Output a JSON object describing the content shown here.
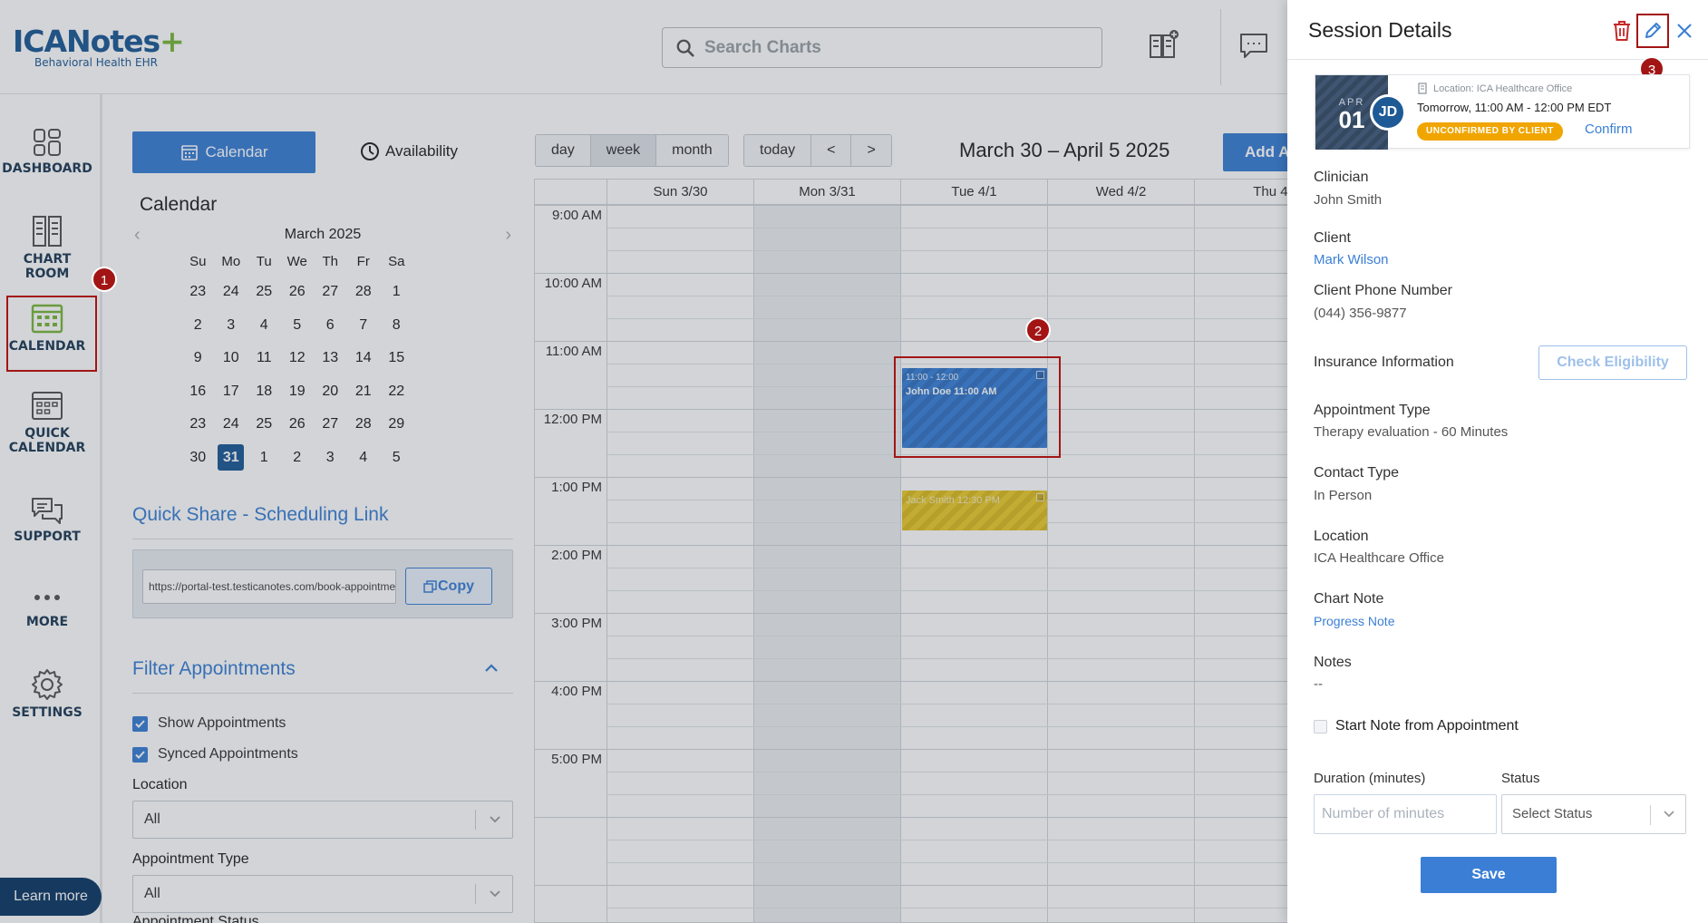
{
  "header": {
    "logo_main": "ICANotes",
    "logo_sub": "Behavioral Health EHR",
    "search_placeholder": "Search Charts"
  },
  "nav": {
    "items": [
      {
        "label": "DASHBOARD",
        "icon": "dashboard-icon"
      },
      {
        "label": "CHART ROOM",
        "icon": "chart-room-icon"
      },
      {
        "label": "CALENDAR",
        "icon": "calendar-icon"
      },
      {
        "label": "QUICK",
        "label2": "CALENDAR",
        "icon": "quick-calendar-icon"
      },
      {
        "label": "SUPPORT",
        "icon": "support-icon"
      },
      {
        "label": "MORE",
        "icon": "more-icon"
      },
      {
        "label": "SETTINGS",
        "icon": "settings-icon"
      }
    ],
    "learn_more": "Learn more"
  },
  "panel": {
    "calendar_btn": "Calendar",
    "availability_btn": "Availability",
    "title": "Calendar",
    "mini_cal": {
      "month": "March 2025",
      "day_names": [
        "Su",
        "Mo",
        "Tu",
        "We",
        "Th",
        "Fr",
        "Sa"
      ],
      "weeks": [
        [
          "23",
          "24",
          "25",
          "26",
          "27",
          "28",
          "1"
        ],
        [
          "2",
          "3",
          "4",
          "5",
          "6",
          "7",
          "8"
        ],
        [
          "9",
          "10",
          "11",
          "12",
          "13",
          "14",
          "15"
        ],
        [
          "16",
          "17",
          "18",
          "19",
          "20",
          "21",
          "22"
        ],
        [
          "23",
          "24",
          "25",
          "26",
          "27",
          "28",
          "29"
        ],
        [
          "30",
          "31",
          "1",
          "2",
          "3",
          "4",
          "5"
        ]
      ],
      "today": "31"
    },
    "quick_share": {
      "title": "Quick Share - Scheduling Link",
      "url": "https://portal-test.testicanotes.com/book-appointment",
      "copy_label": "Copy"
    },
    "filter": {
      "title": "Filter Appointments",
      "show_appointments": "Show Appointments",
      "synced_appointments": "Synced Appointments",
      "location_label": "Location",
      "location_value": "All",
      "appt_type_label": "Appointment Type",
      "appt_type_value": "All",
      "appt_status_label": "Appointment Status"
    }
  },
  "calendar": {
    "views": [
      "day",
      "week",
      "month"
    ],
    "selected_view": "week",
    "nav": [
      "today",
      "<",
      ">"
    ],
    "range_title": "March 30 – April 5 2025",
    "add_btn": "Add A",
    "columns": [
      "Sun 3/30",
      "Mon 3/31",
      "Tue 4/1",
      "Wed 4/2",
      "Thu 4/"
    ],
    "times": [
      "9:00 AM",
      "10:00 AM",
      "11:00 AM",
      "12:00 PM",
      "1:00 PM",
      "2:00 PM",
      "3:00 PM",
      "4:00 PM",
      "5:00 PM"
    ],
    "events": [
      {
        "time": "11:00 - 12:00",
        "title": "John Doe 11:00 AM",
        "color": "#3b82d8"
      },
      {
        "time": "",
        "title": "Jack Smith 12:30 PM",
        "color": "#eccc2f"
      }
    ]
  },
  "markers": [
    "1",
    "2",
    "3"
  ],
  "drawer": {
    "title": "Session Details",
    "card": {
      "month": "APR",
      "day": "01",
      "initials": "JD",
      "location": "Location: ICA Healthcare Office",
      "time": "Tomorrow, 11:00 AM - 12:00 PM EDT",
      "badge": "UNCONFIRMED BY CLIENT",
      "confirm": "Confirm"
    },
    "clinician_label": "Clinician",
    "clinician_value": "John Smith",
    "client_label": "Client",
    "client_value": "Mark Wilson",
    "phone_label": "Client Phone Number",
    "phone_value": "(044) 356-9877",
    "insurance_label": "Insurance Information",
    "check_eligibility": "Check Eligibility",
    "appt_type_label": "Appointment Type",
    "appt_type_value": "Therapy evaluation - 60 Minutes",
    "contact_type_label": "Contact Type",
    "contact_type_value": "In Person",
    "location_label": "Location",
    "location_value": "ICA Healthcare Office",
    "chart_note_label": "Chart Note",
    "chart_note_value": "Progress Note",
    "notes_label": "Notes",
    "notes_value": "--",
    "start_note": "Start Note from Appointment",
    "duration_label": "Duration (minutes)",
    "duration_placeholder": "Number of minutes",
    "status_label": "Status",
    "status_placeholder": "Select Status",
    "save": "Save"
  }
}
